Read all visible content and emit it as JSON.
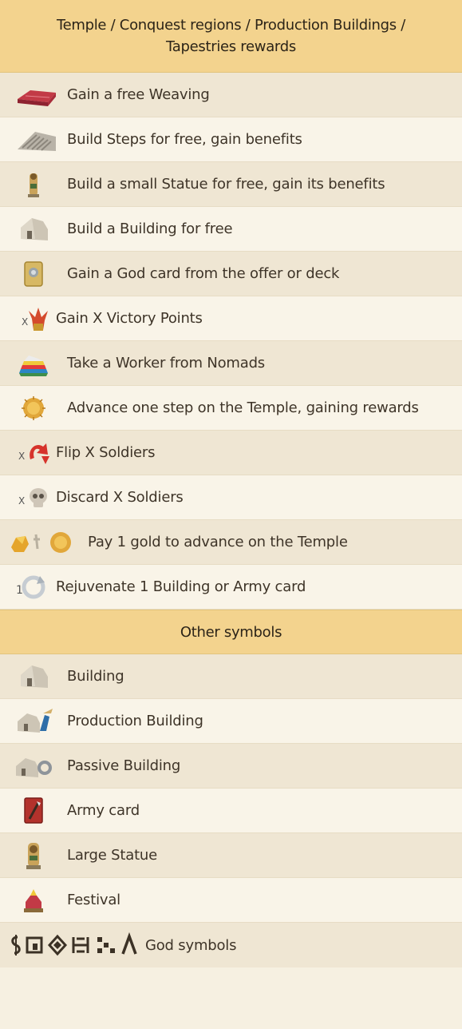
{
  "section1": {
    "title_line1": "Temple / Conquest regions / Production Buildings /",
    "title_line2": "Tapestries rewards",
    "rows": [
      {
        "label": "Gain a free Weaving",
        "icon": "weaving-icon"
      },
      {
        "label": "Build Steps for free, gain benefits",
        "icon": "steps-icon"
      },
      {
        "label": "Build a small Statue for free, gain its benefits",
        "icon": "small-statue-icon"
      },
      {
        "label": "Build a Building for free",
        "icon": "building-icon"
      },
      {
        "label": "Gain a God card from the offer or deck",
        "icon": "god-card-icon"
      },
      {
        "label": "Gain X Victory Points",
        "icon": "victory-points-icon",
        "prefix": "X"
      },
      {
        "label": "Take a Worker from Nomads",
        "icon": "worker-icon"
      },
      {
        "label": "Advance one step on the Temple, gaining rewards",
        "icon": "temple-token-icon"
      },
      {
        "label": "Flip X Soldiers",
        "icon": "flip-arrow-icon",
        "prefix": "X"
      },
      {
        "label": "Discard X Soldiers",
        "icon": "skull-icon",
        "prefix": "X"
      },
      {
        "label": "Pay 1 gold to advance on the Temple",
        "icon": "gold-to-temple-icon"
      },
      {
        "label": "Rejuvenate 1 Building or Army card",
        "icon": "rejuvenate-icon",
        "prefix": "1"
      }
    ]
  },
  "section2": {
    "title": "Other symbols",
    "rows": [
      {
        "label": "Building",
        "icon": "building-icon"
      },
      {
        "label": "Production Building",
        "icon": "production-building-icon"
      },
      {
        "label": "Passive Building",
        "icon": "passive-building-icon"
      },
      {
        "label": "Army card",
        "icon": "army-card-icon"
      },
      {
        "label": "Large Statue",
        "icon": "large-statue-icon"
      },
      {
        "label": "Festival",
        "icon": "festival-icon"
      }
    ],
    "god_row": {
      "label": "God symbols",
      "icon": "god-symbols-icon"
    }
  }
}
